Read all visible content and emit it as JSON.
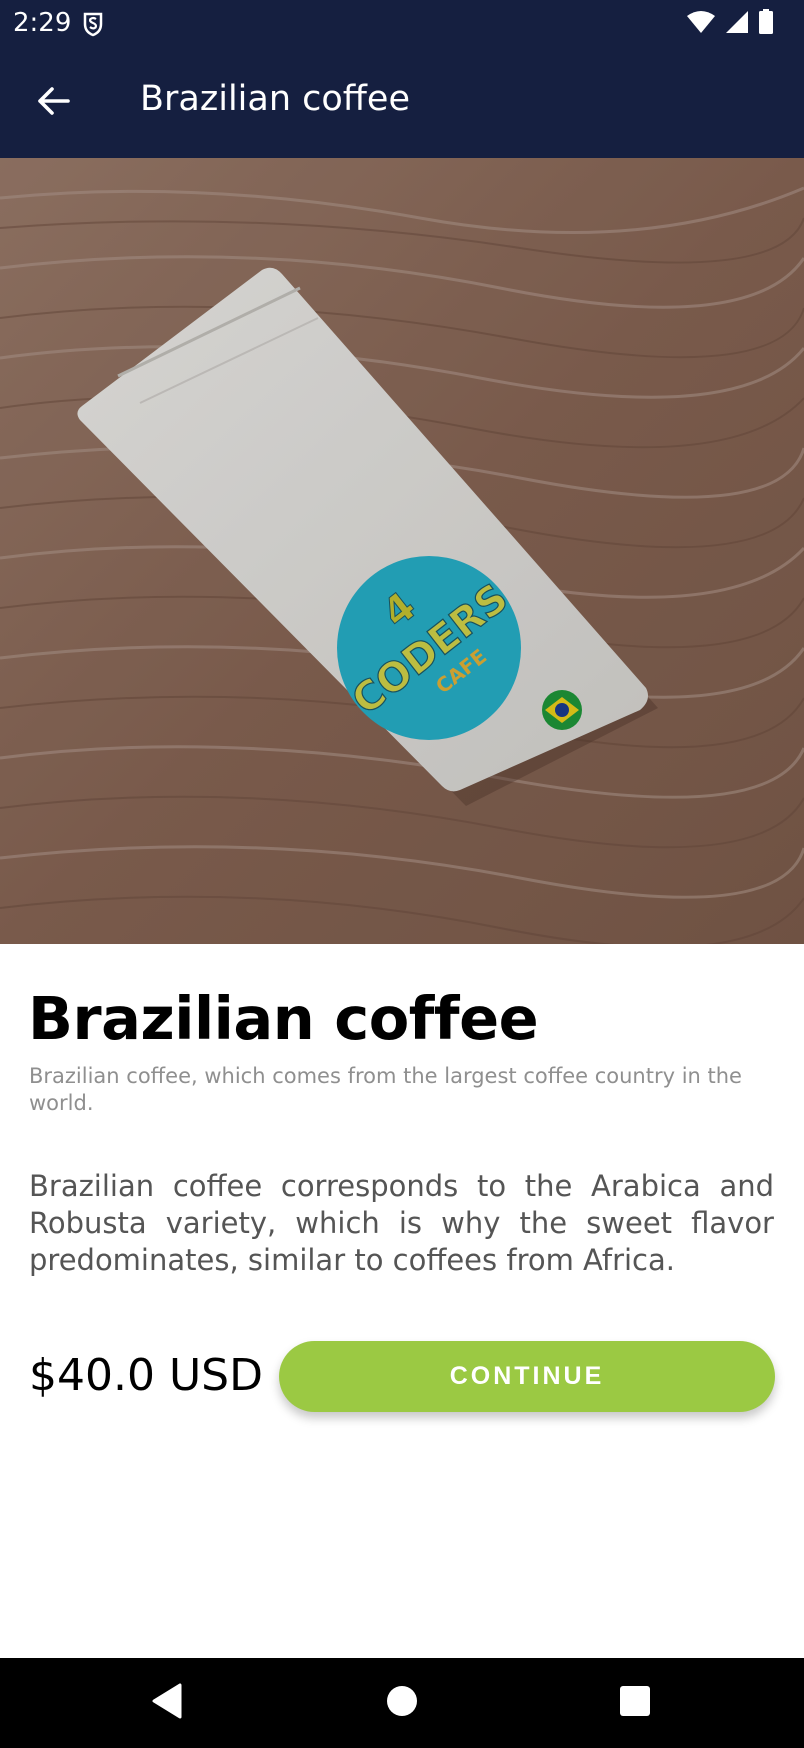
{
  "status_bar": {
    "time": "2:29",
    "icons": [
      "shield-s-icon",
      "wifi-icon",
      "signal-icon",
      "battery-icon"
    ]
  },
  "app_bar": {
    "back_icon": "arrow-left-icon",
    "title": "Brazilian coffee"
  },
  "hero": {
    "image": "coffee bag on wooden table",
    "bag_label": {
      "number": "4",
      "word": "CODERS",
      "sub": "CAFE"
    }
  },
  "product": {
    "title": "Brazilian coffee",
    "subtitle": "Brazilian coffee, which comes from the largest coffee country in the world.",
    "description": "Brazilian coffee corresponds to the Arabica and Robusta variety, which is why the sweet flavor predominates, similar to coffees from Africa.",
    "price": "$40.0 USD",
    "continue_label": "CONTINUE"
  },
  "colors": {
    "app_bar": "#151f40",
    "accent": "#9bc943",
    "label_circle": "#27b3cc"
  },
  "nav_bar": {
    "icons": [
      "back-triangle-icon",
      "home-circle-icon",
      "recents-square-icon"
    ]
  }
}
